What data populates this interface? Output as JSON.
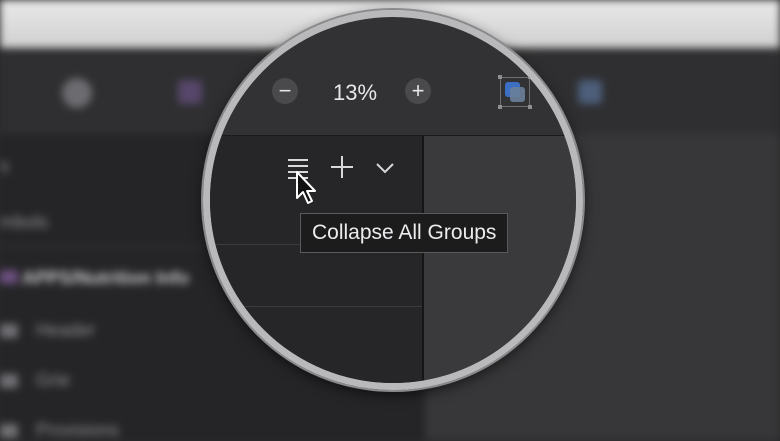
{
  "toolbar": {
    "zoom_out_label": "−",
    "zoom_value": "13%",
    "zoom_in_label": "+"
  },
  "layers_panel": {
    "sidebar_title": "s",
    "dropdown_label": "mbols",
    "group_name": "APPS/Nutrition Info",
    "layers": [
      "Header",
      "Grie",
      "Provisions"
    ],
    "actions": {
      "collapse_icon": "collapse-all-groups-icon",
      "add_icon": "plus-icon",
      "more_icon": "chevron-down-icon"
    }
  },
  "tooltip": {
    "text": "Collapse All Groups"
  },
  "colors": {
    "toolbar_bg": "#323234",
    "panel_bg": "#262628",
    "canvas_bg": "#3a3a3c",
    "lens_border": "#b9b9bb",
    "tooltip_bg": "#1c1c1d"
  }
}
